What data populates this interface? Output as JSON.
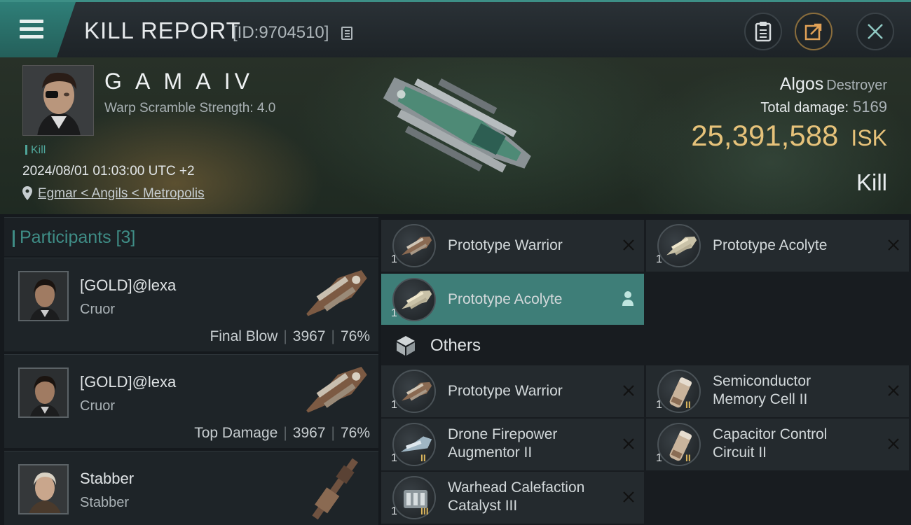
{
  "header": {
    "title": "KILL REPORT",
    "report_id": "[ID:9704510]",
    "icons": [
      "menu-icon",
      "copy-icon",
      "clipboard-icon",
      "share-icon",
      "close-icon"
    ]
  },
  "victim": {
    "name": "G A M A IV",
    "warp_scramble": "Warp Scramble Strength: 4.0",
    "tag": "Kill",
    "datetime": "2024/08/01 01:03:00 UTC +2",
    "location": "Egmar < Angils < Metropolis",
    "ship_name": "Algos",
    "ship_class": "Destroyer",
    "total_damage_label": "Total damage:",
    "total_damage_value": "5169",
    "isk_value": "25,391,588",
    "isk_unit": "ISK",
    "result": "Kill"
  },
  "participants": {
    "header": "Participants [3]",
    "list": [
      {
        "name": "[GOLD]@lexa",
        "ship": "Cruor",
        "role": "Final Blow",
        "damage": "3967",
        "percent": "76%"
      },
      {
        "name": "[GOLD]@lexa",
        "ship": "Cruor",
        "role": "Top Damage",
        "damage": "3967",
        "percent": "76%"
      },
      {
        "name": "Stabber",
        "ship": "Stabber",
        "role": "",
        "damage": "",
        "percent": ""
      }
    ]
  },
  "items": {
    "top": [
      {
        "name": "Prototype  Warrior",
        "qty": "1"
      },
      {
        "name": "Prototype  Acolyte",
        "qty": "1"
      },
      {
        "name": "Prototype  Acolyte",
        "qty": "1"
      }
    ],
    "others_label": "Others",
    "others": [
      {
        "line1": "Prototype  Warrior",
        "line2": "",
        "qty": "1",
        "meta": ""
      },
      {
        "line1": "Semiconductor",
        "line2": "Memory Cell II",
        "qty": "1",
        "meta": "II"
      },
      {
        "line1": "Drone Firepower",
        "line2": "Augmentor II",
        "qty": "1",
        "meta": "II"
      },
      {
        "line1": "Capacitor Control",
        "line2": "Circuit II",
        "qty": "1",
        "meta": "II"
      },
      {
        "line1": "Warhead Calefaction",
        "line2": "Catalyst III",
        "qty": "1",
        "meta": "III"
      }
    ]
  },
  "colors": {
    "accent": "#3e7e78",
    "isk": "#e6c27a",
    "header_teal": "#2f7f78"
  }
}
